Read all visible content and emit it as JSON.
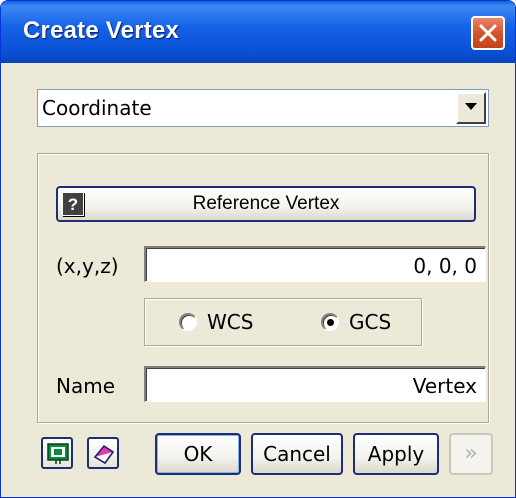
{
  "window": {
    "title": "Create Vertex",
    "close_icon": "close-icon"
  },
  "method": {
    "selected": "Coordinate"
  },
  "reference": {
    "help_icon_glyph": "?",
    "button_label": "Reference Vertex"
  },
  "coords": {
    "label": "(x,y,z)",
    "value": "0, 0, 0"
  },
  "coordinate_system": {
    "options": [
      {
        "label": "WCS",
        "selected": false
      },
      {
        "label": "GCS",
        "selected": true
      }
    ]
  },
  "name": {
    "label": "Name",
    "value": "Vertex"
  },
  "footer": {
    "icons": [
      "preview-icon",
      "eraser-icon"
    ],
    "ok_label": "OK",
    "cancel_label": "Cancel",
    "apply_label": "Apply",
    "expand_label": "»"
  },
  "colors": {
    "title_bar": "#0a4fd2",
    "close_button": "#d7582f",
    "dialog_background": "#ece9d8"
  }
}
